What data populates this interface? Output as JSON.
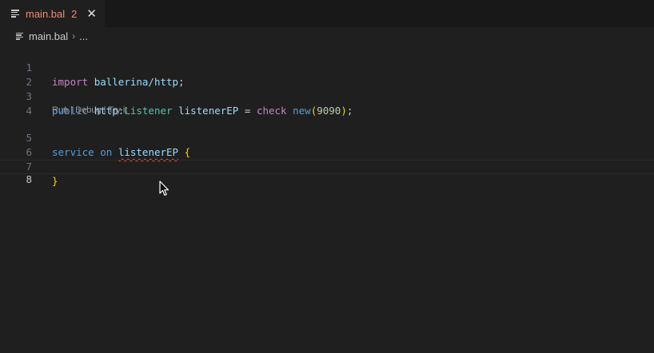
{
  "tab": {
    "file_name": "main.bal",
    "problem_count": "2",
    "close_glyph": "✕",
    "icon": "file-lines-icon"
  },
  "breadcrumb": {
    "file_name": "main.bal",
    "separator": "›",
    "more": "..."
  },
  "editor": {
    "line_numbers": [
      "1",
      "2",
      "3",
      "4",
      "5",
      "6",
      "7",
      "8"
    ],
    "line1": {
      "kw": "import",
      "module": "ballerina/http",
      "semi": ";"
    },
    "line3": {
      "kw": "public",
      "module": "http",
      "colon": ":",
      "type": "Listener",
      "var": "listenerEP",
      "eq": "=",
      "check": "check",
      "new": "new",
      "lparen": "(",
      "port": "9090",
      "rparen": ")",
      "semi": ";"
    },
    "codelens": {
      "run": "Run",
      "sep1": " | ",
      "debug": "Debug",
      "sep2": " | ",
      "try": "Try it"
    },
    "line5": {
      "kw": "service",
      "on": "on",
      "var": "listenerEP",
      "brace": "{"
    },
    "line7": {
      "brace": "}"
    }
  },
  "colors": {
    "background": "#1f1f1f",
    "tab_error": "#f48771",
    "keyword": "#569cd6",
    "control_keyword": "#c586c0",
    "type": "#4ec9b0",
    "variable": "#9cdcfe",
    "number": "#b5cea8",
    "brace": "#ffd700",
    "error_squiggle": "#f14c4c"
  }
}
